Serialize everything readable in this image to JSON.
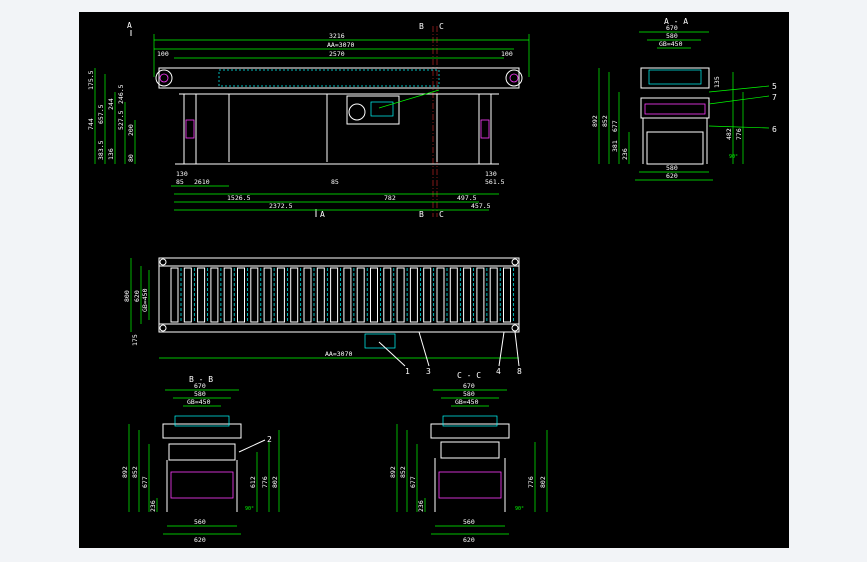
{
  "side_view": {
    "top_dims": [
      "3216",
      "AA=3070",
      "2570",
      "100",
      "100"
    ],
    "bottom_dims": [
      "1526.5",
      "782",
      "2372.5",
      "457.5",
      "2610",
      "85",
      "130",
      "85",
      "130",
      "561.5",
      "497.5"
    ],
    "left_dims": [
      "175.5",
      "744",
      "657.5",
      "244",
      "527.5",
      "200",
      "80",
      "246.5",
      "383.5",
      "136"
    ],
    "section_marks": [
      "A",
      "A",
      "B",
      "B",
      "C",
      "C"
    ]
  },
  "section_aa": {
    "title": "A - A",
    "dims": [
      "670",
      "580",
      "GB=450",
      "580",
      "620",
      "892",
      "852",
      "677",
      "381",
      "236",
      "482",
      "776",
      "135",
      "90°"
    ],
    "callouts": [
      "5",
      "7",
      "6"
    ]
  },
  "plan_view": {
    "left_dims": [
      "800",
      "620",
      "GB=450",
      "175"
    ],
    "bottom_dim": "AA=3070",
    "callouts": [
      "1",
      "3",
      "4",
      "8"
    ]
  },
  "section_bb": {
    "title": "B - B",
    "dims": [
      "670",
      "580",
      "GB=450",
      "560",
      "620",
      "892",
      "852",
      "677",
      "236",
      "612",
      "776",
      "802",
      "90°"
    ],
    "callouts": [
      "2"
    ]
  },
  "section_cc": {
    "title": "C - C",
    "dims": [
      "670",
      "580",
      "GB=450",
      "560",
      "620",
      "892",
      "852",
      "677",
      "236",
      "776",
      "802",
      "90°"
    ]
  },
  "colors": {
    "background": "#000000",
    "dimension": "#00ff00",
    "outline": "#ffffff",
    "hidden": "#00ffff",
    "leg": "#ff3cff"
  }
}
